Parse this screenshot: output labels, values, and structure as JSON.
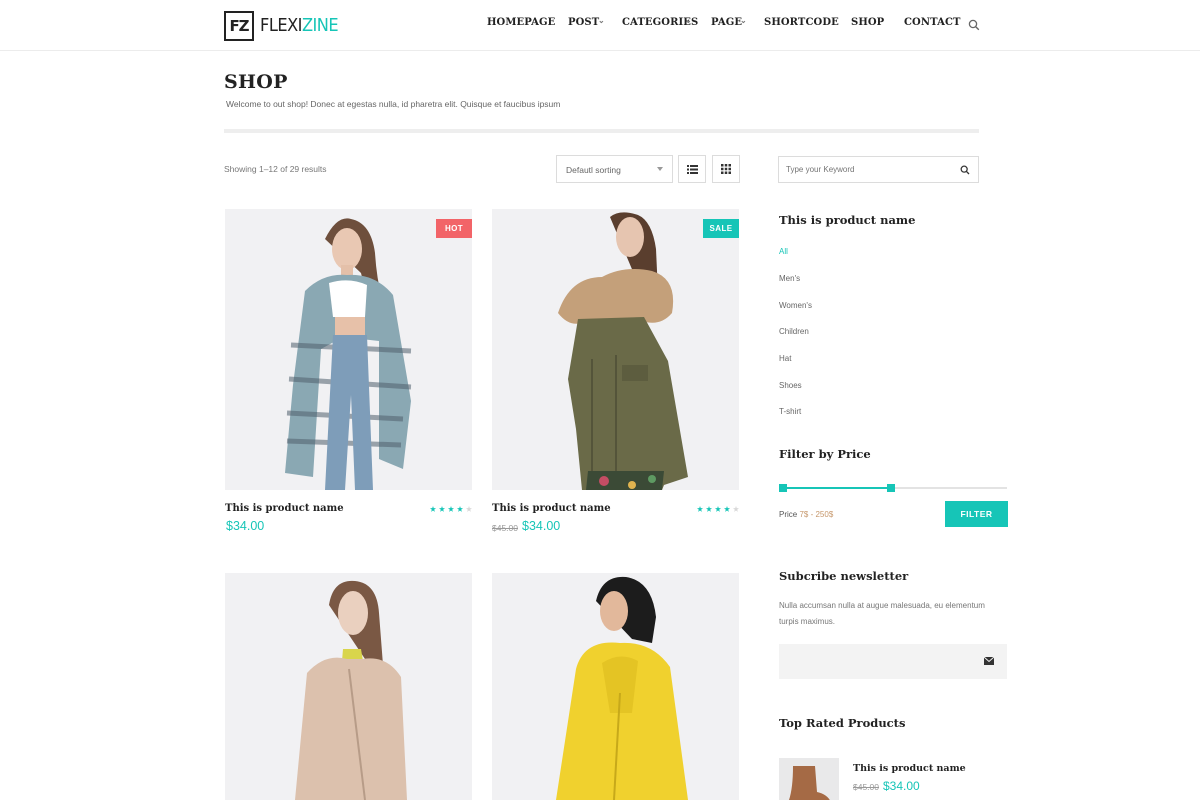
{
  "brand": {
    "logo_mark": "FZ",
    "name_part1": "FLEXI",
    "name_part2": "ZINE",
    "accent": "#16c5b7"
  },
  "nav": {
    "items": [
      {
        "label": "HOMEPAGE",
        "has_dropdown": false
      },
      {
        "label": "POST",
        "has_dropdown": true
      },
      {
        "label": "CATEGORIES",
        "has_dropdown": true
      },
      {
        "label": "PAGE",
        "has_dropdown": true
      },
      {
        "label": "SHORTCODE",
        "has_dropdown": false
      },
      {
        "label": "SHOP",
        "has_dropdown": false
      },
      {
        "label": "CONTACT",
        "has_dropdown": false
      }
    ],
    "search_icon": "search-icon",
    "dropdown_icon": "chevron-down-icon"
  },
  "page": {
    "title": "SHOP",
    "subtitle": "Welcome to out shop! Donec at egestas nulla, id pharetra elit. Quisque et faucibus ipsum"
  },
  "toolbar": {
    "showing": "Showing 1–12 of 29 results",
    "sort_selected": "Defautl sorting",
    "list_view_icon": "list-view-icon",
    "grid_view_icon": "grid-view-icon"
  },
  "products": [
    {
      "name": "This is product name",
      "price": "$34.00",
      "old_price": "",
      "badge": "HOT",
      "badge_color": "#f26468",
      "rating": 4,
      "max_rating": 5,
      "image": "woman-knit-jacket-photo"
    },
    {
      "name": "This is product name",
      "price": "$34.00",
      "old_price": "$45.00",
      "badge": "SALE",
      "badge_color": "#16c5b7",
      "rating": 4,
      "max_rating": 5,
      "image": "woman-parka-fur-hood-photo"
    },
    {
      "name": "",
      "price": "",
      "old_price": "",
      "badge": "",
      "rating": 0,
      "image": "woman-beige-coat-photo"
    },
    {
      "name": "",
      "price": "",
      "old_price": "",
      "badge": "",
      "rating": 0,
      "image": "woman-yellow-raincoat-photo"
    }
  ],
  "sidebar": {
    "search_placeholder": "Type your Keyword",
    "categories_title": "This is product name",
    "categories": [
      "All",
      "Men's",
      "Women's",
      "Children",
      "Hat",
      "Shoes",
      "T-shirt"
    ],
    "active_category": "All",
    "filter_title": "Filter by Price",
    "price_prefix": "Price",
    "price_range": "7$ - 250$",
    "price_slider": {
      "min_fraction": 0.0,
      "max_fraction": 0.49
    },
    "filter_button": "FILTER",
    "newsletter_title": "Subcribe newsletter",
    "newsletter_text": "Nulla accumsan nulla at augue malesuada, eu elementum turpis maximus.",
    "newsletter_icon": "envelope-icon",
    "top_rated_title": "Top Rated Products",
    "top_rated": [
      {
        "name": "This is product name",
        "old_price": "$45.00",
        "price": "$34.00",
        "image": "brown-ankle-boot-photo"
      }
    ]
  }
}
